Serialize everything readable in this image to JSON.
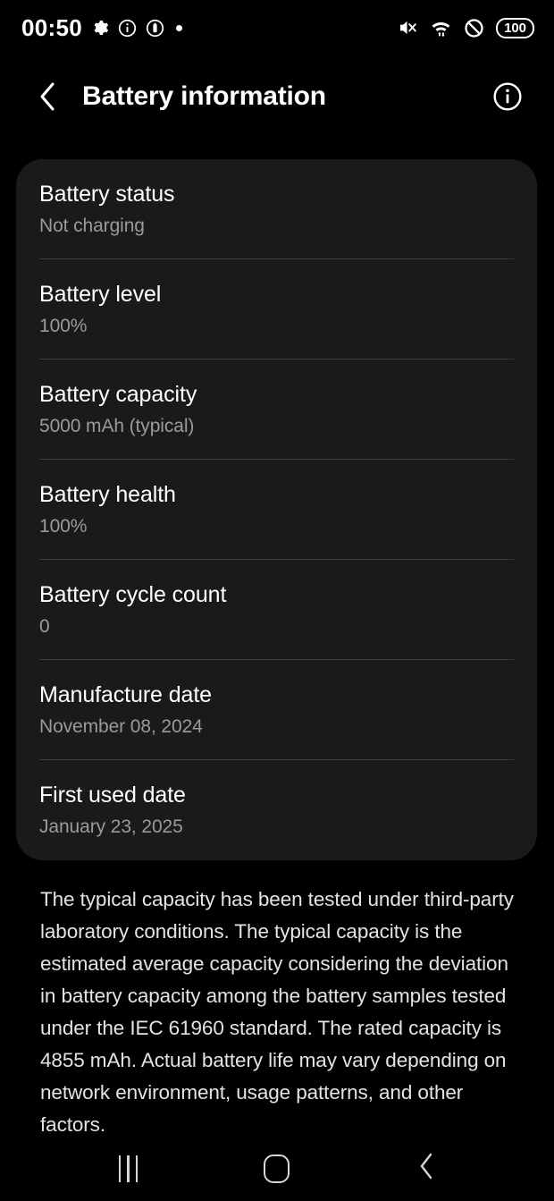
{
  "status_bar": {
    "clock": "00:50",
    "left_icons": [
      "gear-icon",
      "info-circle-icon",
      "battery-circle-icon",
      "dot-icon"
    ],
    "right_icons": [
      "mute-icon",
      "wifi-icon",
      "do-not-disturb-icon"
    ],
    "battery_percent": "100"
  },
  "header": {
    "back_label": "back-chevron",
    "title": "Battery information",
    "info_label": "info-icon"
  },
  "card": {
    "rows": [
      {
        "label": "Battery status",
        "value": "Not charging"
      },
      {
        "label": "Battery level",
        "value": "100%"
      },
      {
        "label": "Battery capacity",
        "value": "5000 mAh (typical)"
      },
      {
        "label": "Battery health",
        "value": "100%"
      },
      {
        "label": "Battery cycle count",
        "value": "0"
      },
      {
        "label": "Manufacture date",
        "value": "November 08, 2024"
      },
      {
        "label": "First used date",
        "value": "January 23, 2025"
      }
    ]
  },
  "footer_note": {
    "text": "The typical capacity has been tested under third-party laboratory conditions. The typical capacity is the estimated average capacity considering the deviation in battery capacity among the battery samples tested under the IEC 61960 standard. The rated capacity is 4855 mAh. Actual battery life may vary depending on network environment, usage patterns, and other factors."
  },
  "nav_bar": {
    "recents": "recents-button",
    "home": "home-button",
    "back": "back-button"
  },
  "colors": {
    "background": "#000000",
    "card": "#1a1a1a",
    "divider": "#3b3b3b",
    "primary_text": "#ffffff",
    "secondary_text": "#9a9a9a"
  }
}
